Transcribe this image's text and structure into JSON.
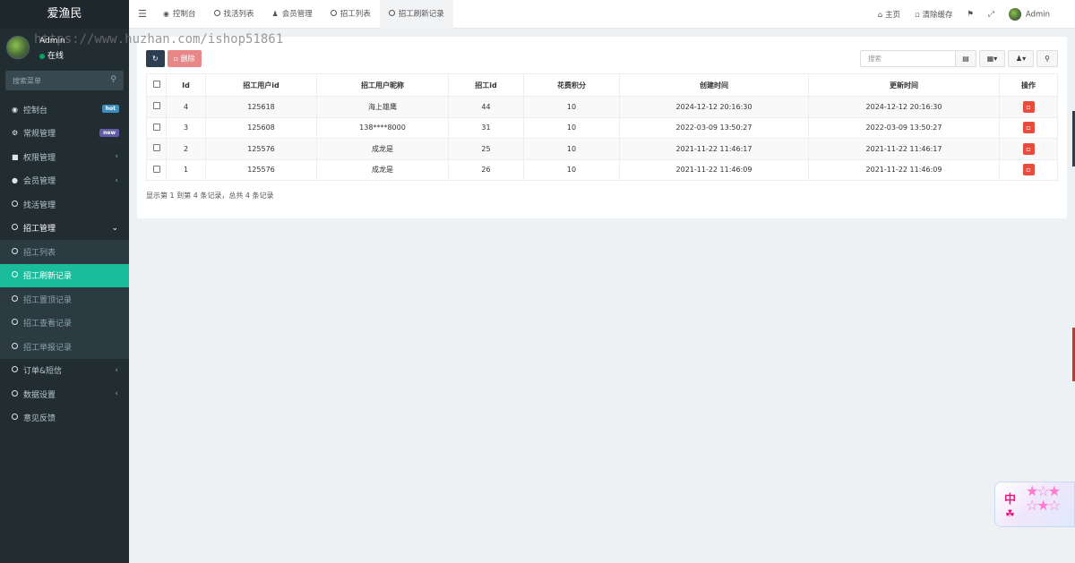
{
  "watermark": "https://www.huzhan.com/ishop51861",
  "sidebar": {
    "brand": "爱渔民",
    "user_name": "Admin",
    "user_status": "在线",
    "search_placeholder": "搜索菜单",
    "items": [
      {
        "label": "控制台",
        "icon": "dashboard-icon",
        "badge": "hot",
        "badge_color": "#3c8dbc"
      },
      {
        "label": "常规管理",
        "icon": "cogs-icon",
        "badge": "new",
        "badge_color": "#605ca8"
      },
      {
        "label": "权限管理",
        "icon": "group-icon",
        "caret": "‹"
      },
      {
        "label": "会员管理",
        "icon": "user-circle-icon",
        "caret": "‹"
      },
      {
        "label": "找活管理",
        "icon": "circle-icon"
      },
      {
        "label": "招工管理",
        "icon": "circle-icon",
        "caret": "⌄"
      }
    ],
    "sub_items": [
      {
        "label": "招工列表"
      },
      {
        "label": "招工刷新记录",
        "active": true
      },
      {
        "label": "招工置顶记录"
      },
      {
        "label": "招工查看记录"
      },
      {
        "label": "招工举报记录"
      }
    ],
    "items_after": [
      {
        "label": "订单&短信",
        "caret": "‹"
      },
      {
        "label": "数据设置",
        "caret": "‹"
      },
      {
        "label": "意见反馈"
      }
    ]
  },
  "topbar": {
    "tabs": [
      {
        "label": "控制台",
        "icon": "dashboard-icon"
      },
      {
        "label": "找活列表",
        "icon": "circle-icon"
      },
      {
        "label": "会员管理",
        "icon": "user-icon"
      },
      {
        "label": "招工列表",
        "icon": "circle-icon"
      },
      {
        "label": "招工刷新记录",
        "icon": "circle-icon",
        "active": true
      }
    ],
    "home": "主页",
    "clear_cache": "清除缓存",
    "user": "Admin"
  },
  "main": {
    "delete_label": "删除",
    "search_placeholder": "搜索",
    "columns": [
      "Id",
      "招工用户id",
      "招工用户昵称",
      "招工id",
      "花费积分",
      "创建时间",
      "更新时间",
      "操作"
    ],
    "rows": [
      [
        "4",
        "125618",
        "海上雄鹰",
        "44",
        "10",
        "2024-12-12 20:16:30",
        "2024-12-12 20:16:30"
      ],
      [
        "3",
        "125608",
        "138****8000",
        "31",
        "10",
        "2022-03-09 13:50:27",
        "2022-03-09 13:50:27"
      ],
      [
        "2",
        "125576",
        "成龙是",
        "25",
        "10",
        "2021-11-22 11:46:17",
        "2021-11-22 11:46:17"
      ],
      [
        "1",
        "125576",
        "成龙是",
        "26",
        "10",
        "2021-11-22 11:46:09",
        "2021-11-22 11:46:09"
      ]
    ],
    "summary": "显示第 1 到第 4 条记录，总共 4 条记录"
  },
  "widget": {
    "label": "中"
  }
}
